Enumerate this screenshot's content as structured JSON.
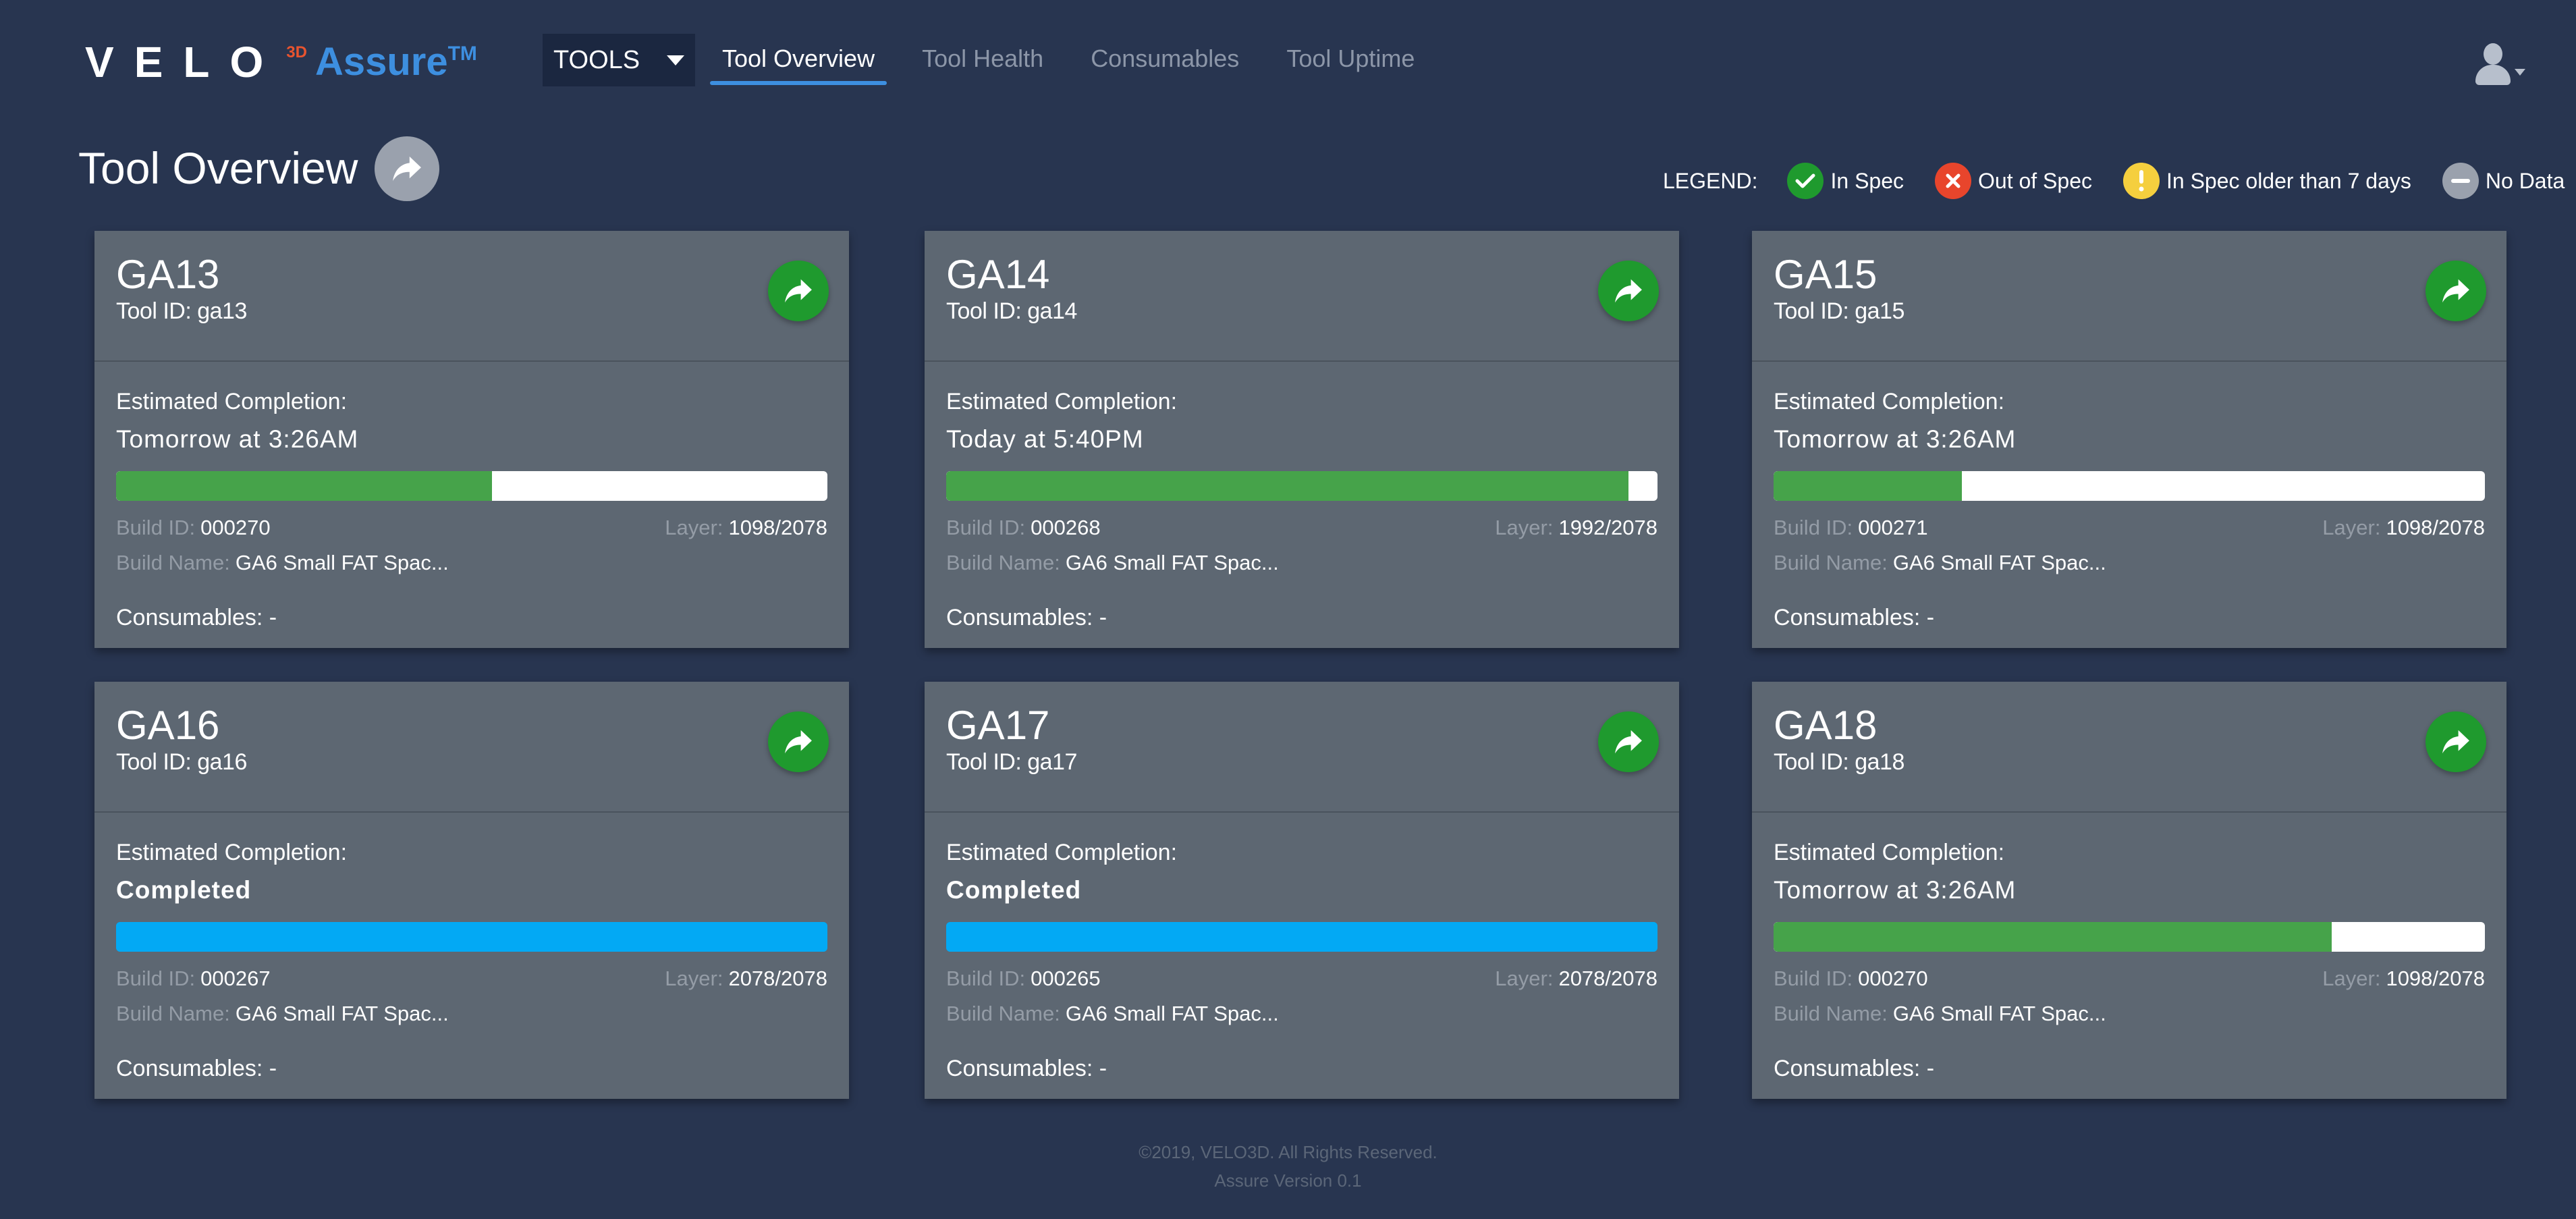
{
  "app": {
    "logo_main": "VELO",
    "logo_sup": "3D",
    "logo_product": "Assure",
    "logo_tm": "TM"
  },
  "header": {
    "tools_select": "TOOLS",
    "tabs": [
      {
        "label": "Tool Overview",
        "active": true
      },
      {
        "label": "Tool Health",
        "active": false
      },
      {
        "label": "Consumables",
        "active": false
      },
      {
        "label": "Tool Uptime",
        "active": false
      }
    ],
    "user_icon": "user-avatar-icon"
  },
  "page": {
    "title": "Tool Overview",
    "title_action_icon": "share-arrow-icon"
  },
  "legend": {
    "title": "LEGEND:",
    "items": [
      {
        "label": "In Spec",
        "color": "#1f9a2e",
        "icon": "check-icon"
      },
      {
        "label": "Out of Spec",
        "color": "#e8452c",
        "icon": "x-icon"
      },
      {
        "label": "In Spec older than 7 days",
        "color": "#f5cf3e",
        "icon": "exclamation-icon"
      },
      {
        "label": "No Data",
        "color": "#9aa1ad",
        "icon": "minus-icon"
      }
    ]
  },
  "cards": [
    {
      "name": "GA13",
      "tool_id": "Tool ID: ga13",
      "est_label": "Estimated Completion:",
      "est_value": "Tomorrow at 3:26AM",
      "completed": false,
      "progress": 0.528,
      "build_id_label": "Build ID:",
      "build_id": "000270",
      "layer_label": "Layer:",
      "layer": "1098/2078",
      "build_name_label": "Build Name:",
      "build_name": "GA6 Small FAT Spac...",
      "consumables": "Consumables: -"
    },
    {
      "name": "GA14",
      "tool_id": "Tool ID: ga14",
      "est_label": "Estimated Completion:",
      "est_value": "Today at 5:40PM",
      "completed": false,
      "progress": 0.959,
      "build_id_label": "Build ID:",
      "build_id": "000268",
      "layer_label": "Layer:",
      "layer": "1992/2078",
      "build_name_label": "Build Name:",
      "build_name": "GA6 Small FAT Spac...",
      "consumables": "Consumables: -"
    },
    {
      "name": "GA15",
      "tool_id": "Tool ID: ga15",
      "est_label": "Estimated Completion:",
      "est_value": "Tomorrow at 3:26AM",
      "completed": false,
      "progress": 0.265,
      "build_id_label": "Build ID:",
      "build_id": "000271",
      "layer_label": "Layer:",
      "layer": "1098/2078",
      "build_name_label": "Build Name:",
      "build_name": "GA6 Small FAT Spac...",
      "consumables": "Consumables: -"
    },
    {
      "name": "GA16",
      "tool_id": "Tool ID: ga16",
      "est_label": "Estimated Completion:",
      "est_value": "Completed",
      "completed": true,
      "progress": 1.0,
      "build_id_label": "Build ID:",
      "build_id": "000267",
      "layer_label": "Layer:",
      "layer": "2078/2078",
      "build_name_label": "Build Name:",
      "build_name": "GA6 Small FAT Spac...",
      "consumables": "Consumables: -"
    },
    {
      "name": "GA17",
      "tool_id": "Tool ID: ga17",
      "est_label": "Estimated Completion:",
      "est_value": "Completed",
      "completed": true,
      "progress": 1.0,
      "build_id_label": "Build ID:",
      "build_id": "000265",
      "layer_label": "Layer:",
      "layer": "2078/2078",
      "build_name_label": "Build Name:",
      "build_name": "GA6 Small FAT Spac...",
      "consumables": "Consumables: -"
    },
    {
      "name": "GA18",
      "tool_id": "Tool ID: ga18",
      "est_label": "Estimated Completion:",
      "est_value": "Tomorrow at 3:26AM",
      "completed": false,
      "progress": 0.785,
      "build_id_label": "Build ID:",
      "build_id": "000270",
      "layer_label": "Layer:",
      "layer": "1098/2078",
      "build_name_label": "Build Name:",
      "build_name": "GA6 Small FAT Spac...",
      "consumables": "Consumables: -"
    }
  ],
  "card_action_icon": "share-arrow-icon",
  "footer": {
    "copyright": "©2019, VELO3D. All Rights Reserved.",
    "version": "Assure Version 0.1"
  }
}
